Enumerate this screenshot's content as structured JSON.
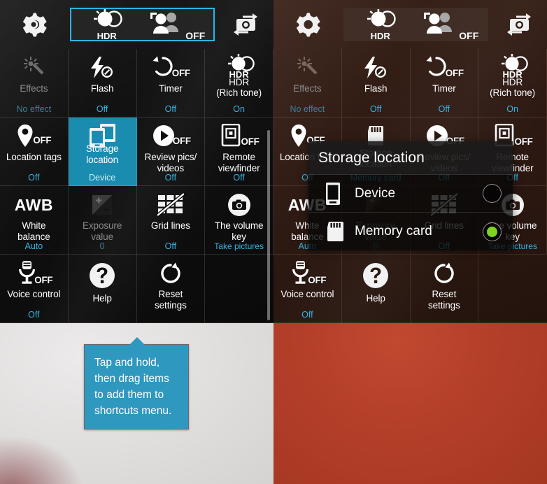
{
  "colors": {
    "accent_blue": "#33b5e5",
    "selected_tile": "#1a8cb0",
    "shortcut_border": "#29b6e8",
    "radio_green": "#7ed321",
    "tooltip_bg": "#2e98bf",
    "left_preview": "#e2e0df",
    "right_preview": "#b5402a"
  },
  "topbar": {
    "settings_icon": "gear-icon",
    "switch_icon": "switch-camera-icon",
    "shortcuts": [
      {
        "icon": "hdr-icon",
        "label": "HDR"
      },
      {
        "icon": "shot-mode-people-icon",
        "label": "OFF"
      }
    ]
  },
  "settings_grid": {
    "rows": [
      [
        {
          "icon": "effects-magic-wand-icon",
          "label": "Effects",
          "value": "No effect",
          "state": "dim"
        },
        {
          "icon": "flash-off-icon",
          "label": "Flash",
          "value": "Off",
          "state": "normal",
          "overlay": ""
        },
        {
          "icon": "timer-icon",
          "label": "Timer",
          "value": "Off",
          "state": "normal",
          "overlay": "OFF"
        },
        {
          "icon": "hdr-icon",
          "label": "HDR\n(Rich tone)",
          "label_tag": "HDR",
          "value": "On",
          "state": "normal"
        }
      ],
      [
        {
          "icon": "location-pin-icon",
          "label": "Location tags",
          "value": "Off",
          "state": "normal",
          "overlay": "OFF"
        },
        {
          "icon": "storage-device-icon",
          "label": "Storage\nlocation",
          "value": "Device",
          "state": "selected"
        },
        {
          "icon": "review-play-icon",
          "label": "Review pics/\nvideos",
          "value": "Off",
          "state": "normal",
          "overlay": "OFF"
        },
        {
          "icon": "remote-viewfinder-icon",
          "label": "Remote\nviewfinder",
          "value": "Off",
          "state": "normal",
          "overlay": "OFF"
        }
      ],
      [
        {
          "icon": "awb-text-icon",
          "label": "White\nbalance",
          "value": "Auto",
          "state": "normal"
        },
        {
          "icon": "exposure-value-icon",
          "label": "Exposure\nvalue",
          "value": "0",
          "state": "dim"
        },
        {
          "icon": "grid-lines-off-icon",
          "label": "Grid lines",
          "value": "Off",
          "state": "normal"
        },
        {
          "icon": "camera-shutter-icon",
          "label": "The volume\nkey",
          "value": "Take pictures",
          "state": "normal"
        }
      ],
      [
        {
          "icon": "voice-control-mic-icon",
          "label": "Voice control",
          "value": "Off",
          "state": "normal",
          "overlay": "OFF"
        },
        {
          "icon": "help-question-icon",
          "label": "Help",
          "value": "",
          "state": "normal"
        },
        {
          "icon": "reset-refresh-icon",
          "label": "Reset\nsettings",
          "value": "",
          "state": "normal"
        },
        {
          "icon": "",
          "label": "",
          "value": "",
          "state": "empty"
        }
      ]
    ],
    "right_overrides": {
      "storage_icon": "memory-card-icon",
      "storage_value": "Memory card"
    }
  },
  "tooltip": {
    "text": "Tap and hold, then drag items to add them to shortcuts menu."
  },
  "dialog": {
    "title": "Storage location",
    "options": [
      {
        "icon": "phone-device-icon",
        "label": "Device",
        "selected": false
      },
      {
        "icon": "memory-card-icon",
        "label": "Memory card",
        "selected": true
      }
    ]
  }
}
